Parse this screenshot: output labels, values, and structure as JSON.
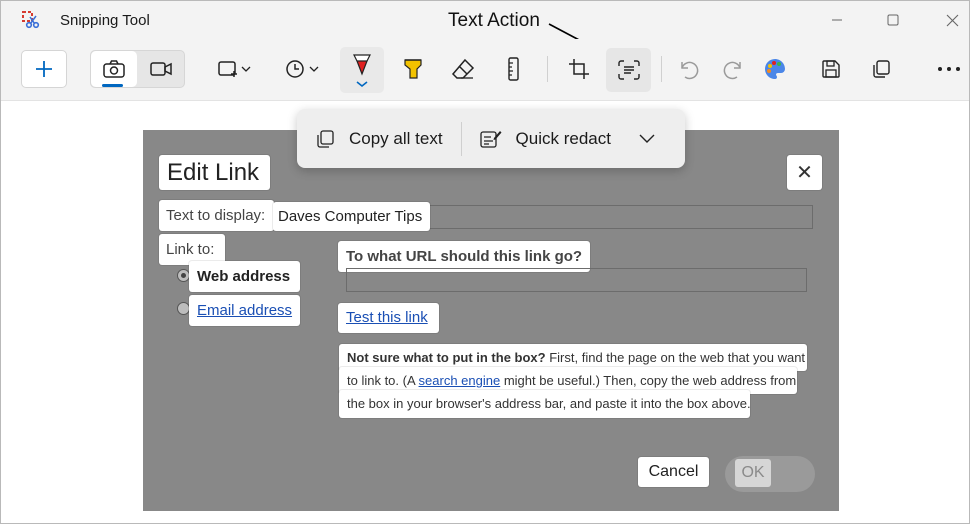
{
  "window": {
    "app_title": "Snipping Tool"
  },
  "annotation": {
    "text": "Text Action"
  },
  "toolbar": {
    "icons": [
      "new-snip",
      "screenshot-mode",
      "video-mode",
      "rectangle-snip",
      "delay-timer",
      "ballpoint-pen",
      "highlighter",
      "eraser",
      "ruler",
      "crop",
      "text-action",
      "undo",
      "redo",
      "paint",
      "save",
      "copy",
      "more"
    ]
  },
  "text_menu": {
    "copy_all_label": "Copy all text",
    "quick_redact_label": "Quick redact"
  },
  "dialog": {
    "title": "Edit Link",
    "text_to_display_label": "Text to display:",
    "text_to_display_value": "Daves Computer Tips",
    "link_to_label": "Link to:",
    "web_address_label": "Web address",
    "email_address_label": "Email address",
    "url_question": "To what URL should this link go?",
    "test_link": "Test this link",
    "help_bold": "Not sure what to put in the box?",
    "help_line1_rest": " First, find the page on the web that you want",
    "help_line2_pre": "to link to. (A ",
    "help_link": "search engine",
    "help_line2_post": " might be useful.) Then, copy the web address from",
    "help_line3": "the box in your browser's address bar, and paste it into the box above.",
    "cancel_label": "Cancel",
    "ok_label": "OK",
    "close_glyph": "✕"
  },
  "colors": {
    "accent": "#0067c0",
    "screenshot_gray": "#888888",
    "link_blue": "#1a4fb4",
    "pen_red": "#e02020",
    "highlighter_yellow": "#f2c200"
  }
}
